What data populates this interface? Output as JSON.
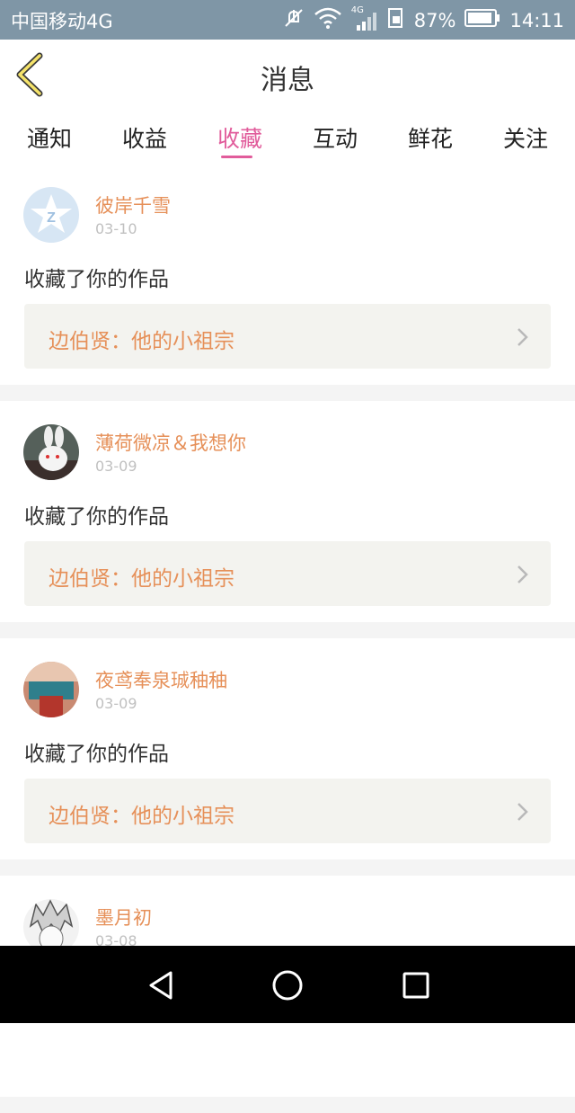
{
  "status_bar": {
    "carrier": "中国移动4G",
    "network_badge": "4G",
    "battery": "87%",
    "time": "14:11"
  },
  "header": {
    "title": "消息",
    "back_icon": "chevron-left-icon"
  },
  "tabs": [
    {
      "label": "通知",
      "active": false
    },
    {
      "label": "收益",
      "active": false
    },
    {
      "label": "收藏",
      "active": true
    },
    {
      "label": "互动",
      "active": false
    },
    {
      "label": "鲜花",
      "active": false
    },
    {
      "label": "关注",
      "active": false
    }
  ],
  "items": [
    {
      "user": "彼岸千雪",
      "date": "03-10",
      "message": "收藏了你的作品",
      "work": "边伯贤：他的小祖宗",
      "avatar": "default-qq-avatar"
    },
    {
      "user": "薄荷微凉＆我想你",
      "date": "03-09",
      "message": "收藏了你的作品",
      "work": "边伯贤：他的小祖宗",
      "avatar": "bunny-photo-avatar"
    },
    {
      "user": "夜鸢奉泉珹秞秞",
      "date": "03-09",
      "message": "收藏了你的作品",
      "work": "边伯贤：他的小祖宗",
      "avatar": "photo-avatar"
    },
    {
      "user": "墨月初",
      "date": "03-08",
      "message": "",
      "work": "",
      "avatar": "anime-avatar"
    }
  ],
  "colors": {
    "accent": "#e15c9b",
    "username": "#e69059",
    "status_bar": "#7f96a6"
  }
}
